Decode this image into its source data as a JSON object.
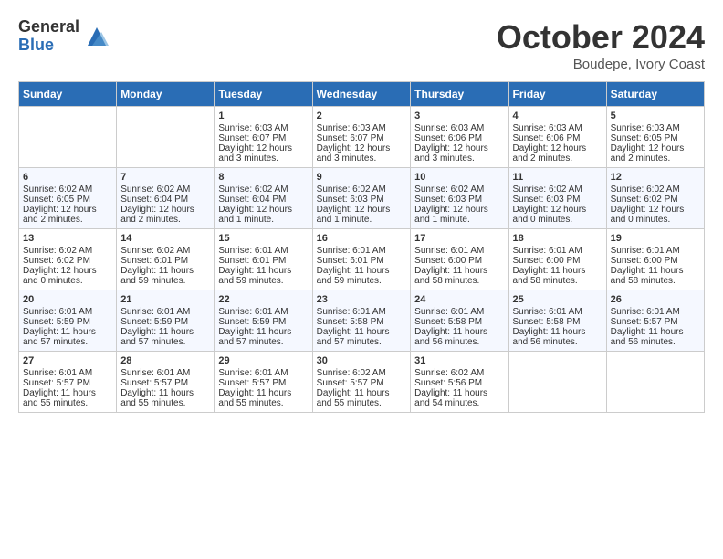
{
  "logo": {
    "general": "General",
    "blue": "Blue"
  },
  "title": "October 2024",
  "subtitle": "Boudepe, Ivory Coast",
  "days_of_week": [
    "Sunday",
    "Monday",
    "Tuesday",
    "Wednesday",
    "Thursday",
    "Friday",
    "Saturday"
  ],
  "weeks": [
    [
      {
        "day": "",
        "content": ""
      },
      {
        "day": "",
        "content": ""
      },
      {
        "day": "1",
        "content": "Sunrise: 6:03 AM\nSunset: 6:07 PM\nDaylight: 12 hours and 3 minutes."
      },
      {
        "day": "2",
        "content": "Sunrise: 6:03 AM\nSunset: 6:07 PM\nDaylight: 12 hours and 3 minutes."
      },
      {
        "day": "3",
        "content": "Sunrise: 6:03 AM\nSunset: 6:06 PM\nDaylight: 12 hours and 3 minutes."
      },
      {
        "day": "4",
        "content": "Sunrise: 6:03 AM\nSunset: 6:06 PM\nDaylight: 12 hours and 2 minutes."
      },
      {
        "day": "5",
        "content": "Sunrise: 6:03 AM\nSunset: 6:05 PM\nDaylight: 12 hours and 2 minutes."
      }
    ],
    [
      {
        "day": "6",
        "content": "Sunrise: 6:02 AM\nSunset: 6:05 PM\nDaylight: 12 hours and 2 minutes."
      },
      {
        "day": "7",
        "content": "Sunrise: 6:02 AM\nSunset: 6:04 PM\nDaylight: 12 hours and 2 minutes."
      },
      {
        "day": "8",
        "content": "Sunrise: 6:02 AM\nSunset: 6:04 PM\nDaylight: 12 hours and 1 minute."
      },
      {
        "day": "9",
        "content": "Sunrise: 6:02 AM\nSunset: 6:03 PM\nDaylight: 12 hours and 1 minute."
      },
      {
        "day": "10",
        "content": "Sunrise: 6:02 AM\nSunset: 6:03 PM\nDaylight: 12 hours and 1 minute."
      },
      {
        "day": "11",
        "content": "Sunrise: 6:02 AM\nSunset: 6:03 PM\nDaylight: 12 hours and 0 minutes."
      },
      {
        "day": "12",
        "content": "Sunrise: 6:02 AM\nSunset: 6:02 PM\nDaylight: 12 hours and 0 minutes."
      }
    ],
    [
      {
        "day": "13",
        "content": "Sunrise: 6:02 AM\nSunset: 6:02 PM\nDaylight: 12 hours and 0 minutes."
      },
      {
        "day": "14",
        "content": "Sunrise: 6:02 AM\nSunset: 6:01 PM\nDaylight: 11 hours and 59 minutes."
      },
      {
        "day": "15",
        "content": "Sunrise: 6:01 AM\nSunset: 6:01 PM\nDaylight: 11 hours and 59 minutes."
      },
      {
        "day": "16",
        "content": "Sunrise: 6:01 AM\nSunset: 6:01 PM\nDaylight: 11 hours and 59 minutes."
      },
      {
        "day": "17",
        "content": "Sunrise: 6:01 AM\nSunset: 6:00 PM\nDaylight: 11 hours and 58 minutes."
      },
      {
        "day": "18",
        "content": "Sunrise: 6:01 AM\nSunset: 6:00 PM\nDaylight: 11 hours and 58 minutes."
      },
      {
        "day": "19",
        "content": "Sunrise: 6:01 AM\nSunset: 6:00 PM\nDaylight: 11 hours and 58 minutes."
      }
    ],
    [
      {
        "day": "20",
        "content": "Sunrise: 6:01 AM\nSunset: 5:59 PM\nDaylight: 11 hours and 57 minutes."
      },
      {
        "day": "21",
        "content": "Sunrise: 6:01 AM\nSunset: 5:59 PM\nDaylight: 11 hours and 57 minutes."
      },
      {
        "day": "22",
        "content": "Sunrise: 6:01 AM\nSunset: 5:59 PM\nDaylight: 11 hours and 57 minutes."
      },
      {
        "day": "23",
        "content": "Sunrise: 6:01 AM\nSunset: 5:58 PM\nDaylight: 11 hours and 57 minutes."
      },
      {
        "day": "24",
        "content": "Sunrise: 6:01 AM\nSunset: 5:58 PM\nDaylight: 11 hours and 56 minutes."
      },
      {
        "day": "25",
        "content": "Sunrise: 6:01 AM\nSunset: 5:58 PM\nDaylight: 11 hours and 56 minutes."
      },
      {
        "day": "26",
        "content": "Sunrise: 6:01 AM\nSunset: 5:57 PM\nDaylight: 11 hours and 56 minutes."
      }
    ],
    [
      {
        "day": "27",
        "content": "Sunrise: 6:01 AM\nSunset: 5:57 PM\nDaylight: 11 hours and 55 minutes."
      },
      {
        "day": "28",
        "content": "Sunrise: 6:01 AM\nSunset: 5:57 PM\nDaylight: 11 hours and 55 minutes."
      },
      {
        "day": "29",
        "content": "Sunrise: 6:01 AM\nSunset: 5:57 PM\nDaylight: 11 hours and 55 minutes."
      },
      {
        "day": "30",
        "content": "Sunrise: 6:02 AM\nSunset: 5:57 PM\nDaylight: 11 hours and 55 minutes."
      },
      {
        "day": "31",
        "content": "Sunrise: 6:02 AM\nSunset: 5:56 PM\nDaylight: 11 hours and 54 minutes."
      },
      {
        "day": "",
        "content": ""
      },
      {
        "day": "",
        "content": ""
      }
    ]
  ]
}
